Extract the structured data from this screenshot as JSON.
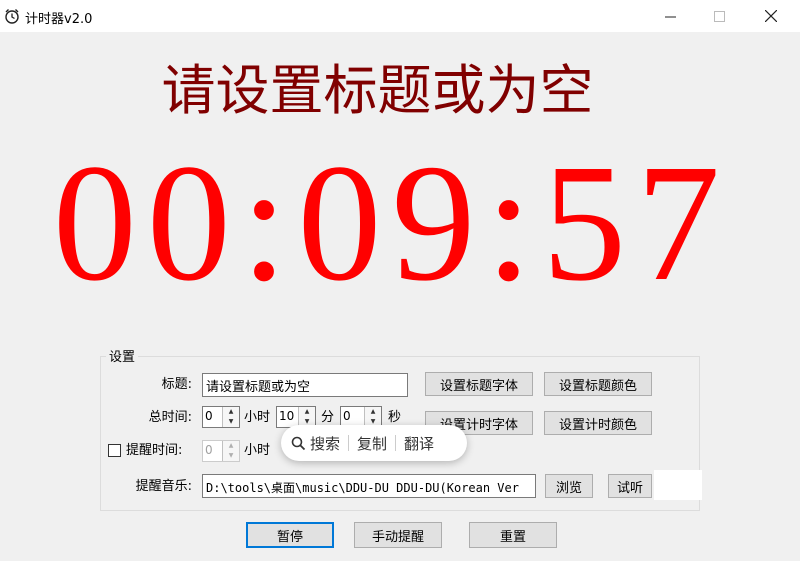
{
  "window": {
    "title": "计时器v2.0"
  },
  "display": {
    "title": "请设置标题或为空",
    "time": "00:09:57"
  },
  "settings": {
    "group_label": "设置",
    "title_label": "标题:",
    "title_value": "请设置标题或为空",
    "total_label": "总时间:",
    "hours": "0",
    "hours_unit": "小时",
    "minutes": "10",
    "minutes_unit": "分",
    "seconds": "0",
    "seconds_unit": "秒",
    "remind_label": "提醒时间:",
    "remind_checked": false,
    "remind_value": "0",
    "remind_unit": "小时",
    "music_label": "提醒音乐:",
    "music_path": "D:\\tools\\桌面\\music\\DDU-DU  DDU-DU(Korean  Ver",
    "btn_title_font": "设置标题字体",
    "btn_title_color": "设置标题颜色",
    "btn_timer_font": "设置计时字体",
    "btn_timer_color": "设置计时颜色",
    "btn_browse": "浏览",
    "btn_listen": "试听"
  },
  "actions": {
    "pause": "暂停",
    "manual_remind": "手动提醒",
    "reset": "重置"
  },
  "popup": {
    "search": "搜索",
    "copy": "复制",
    "translate": "翻译"
  },
  "colors": {
    "title": "#800000",
    "countdown": "#ff0000",
    "focus": "#0078d7"
  }
}
